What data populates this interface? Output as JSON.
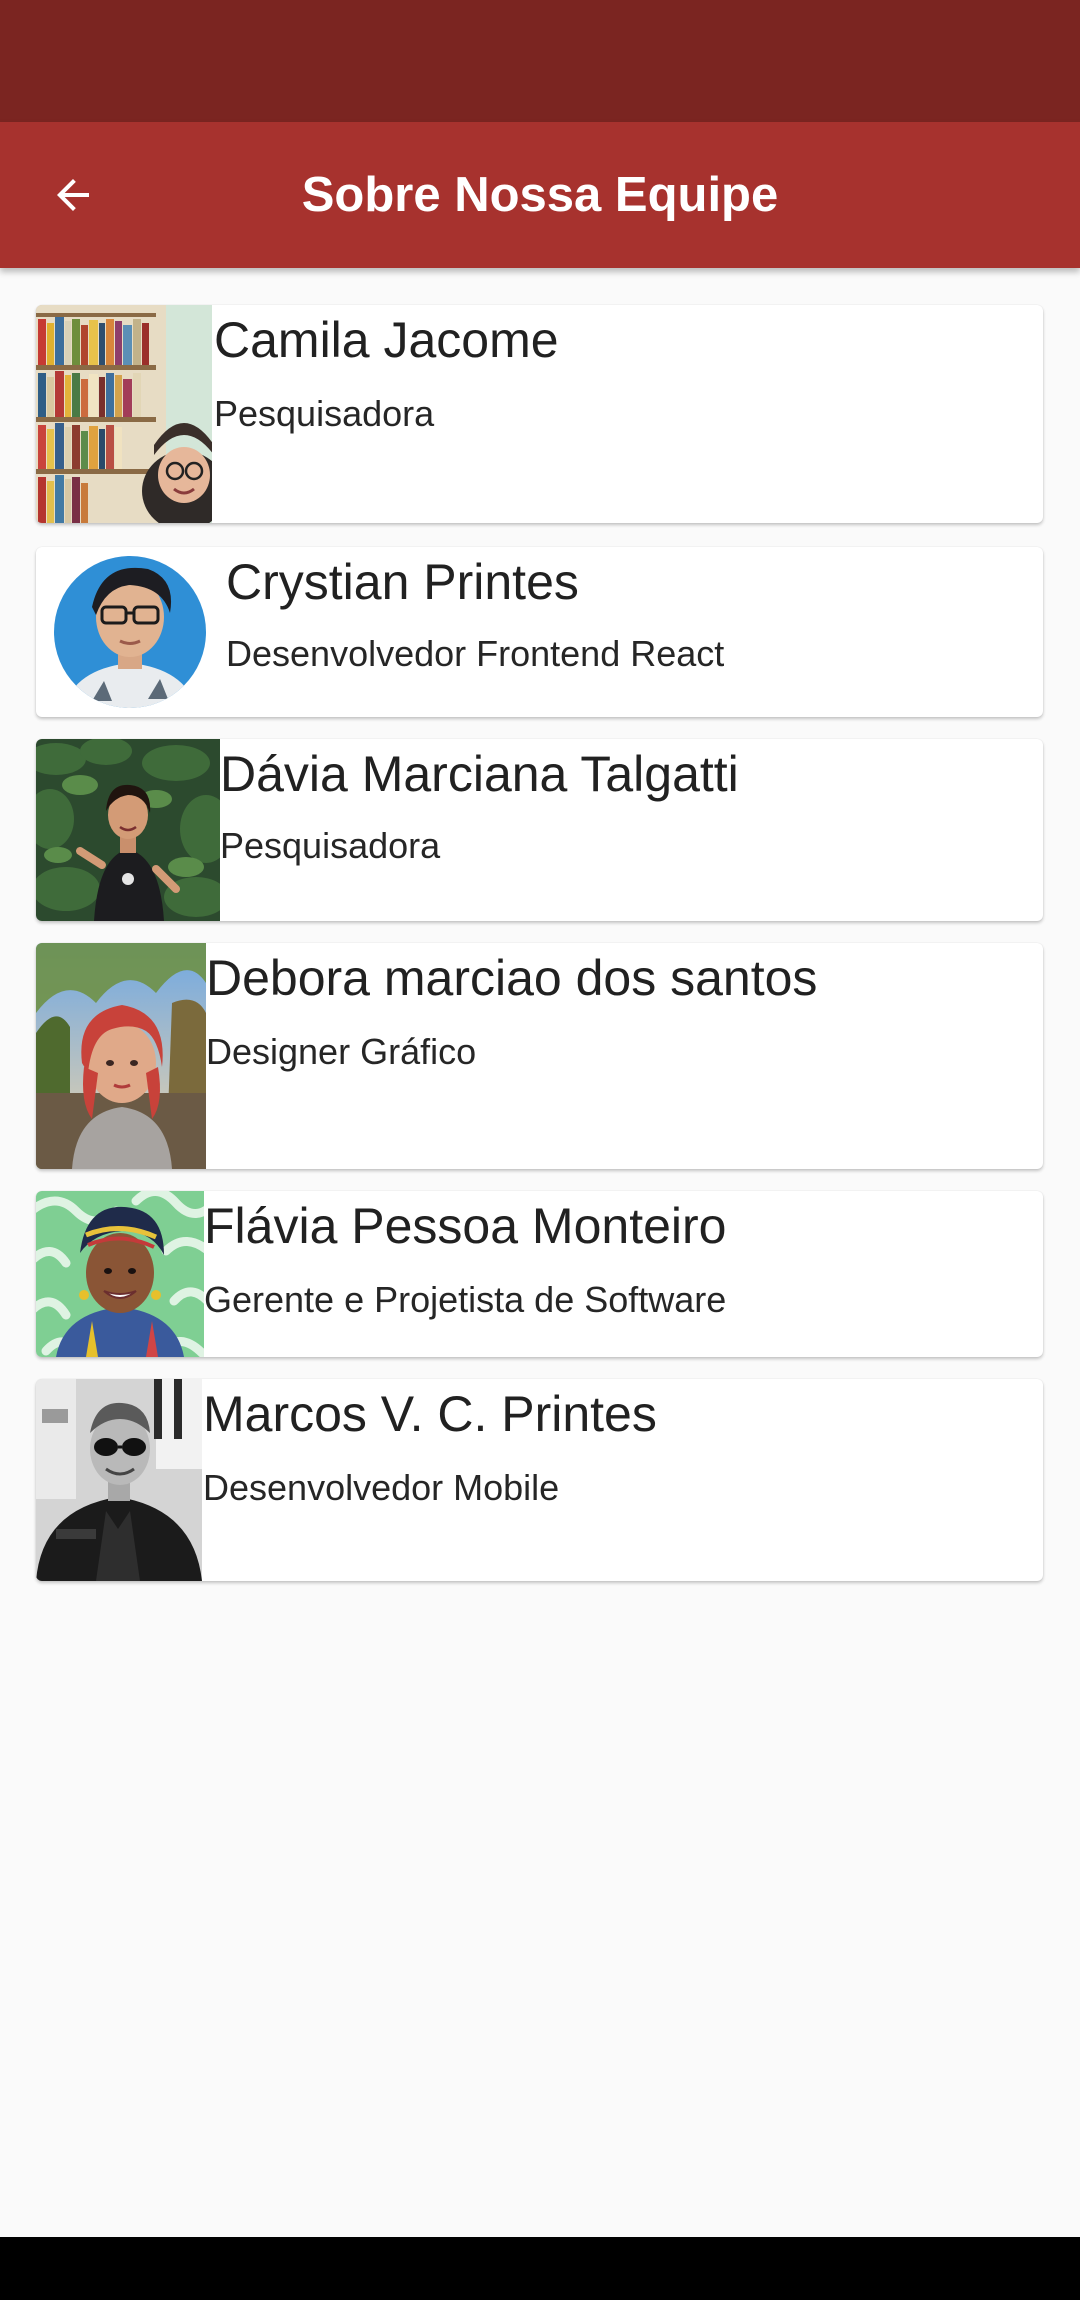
{
  "app_bar": {
    "title": "Sobre Nossa Equipe",
    "back_icon": "arrow-left-icon"
  },
  "colors": {
    "status_bar": "#7b2521",
    "app_bar": "#a7322e",
    "background": "#fafafa",
    "card": "#ffffff"
  },
  "team": [
    {
      "name": "Camila Jacome",
      "role": "Pesquisadora"
    },
    {
      "name": "Crystian Printes",
      "role": "Desenvolvedor Frontend React"
    },
    {
      "name": "Dávia Marciana Talgatti",
      "role": "Pesquisadora"
    },
    {
      "name": "Debora marciao dos santos",
      "role": "Designer Gráfico"
    },
    {
      "name": "Flávia Pessoa Monteiro",
      "role": "Gerente e Projetista de Software"
    },
    {
      "name": "Marcos V. C. Printes",
      "role": "Desenvolvedor Mobile"
    }
  ]
}
